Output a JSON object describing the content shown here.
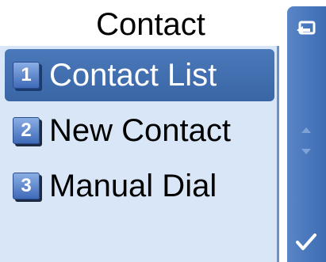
{
  "header": {
    "title": "Contact"
  },
  "menu": {
    "items": [
      {
        "number": "1",
        "label": "Contact List",
        "selected": true
      },
      {
        "number": "2",
        "label": "New Contact",
        "selected": false
      },
      {
        "number": "3",
        "label": "Manual Dial",
        "selected": false
      }
    ]
  },
  "side_bar": {
    "top_icon": "back-icon",
    "middle_icon": "scroll-arrows-icon",
    "bottom_icon": "checkmark-icon"
  },
  "colors": {
    "panel_background": "#d9e6f8",
    "selection": "#4472b3",
    "side_bar": "#4a78bc",
    "badge": "#5d86cc"
  }
}
